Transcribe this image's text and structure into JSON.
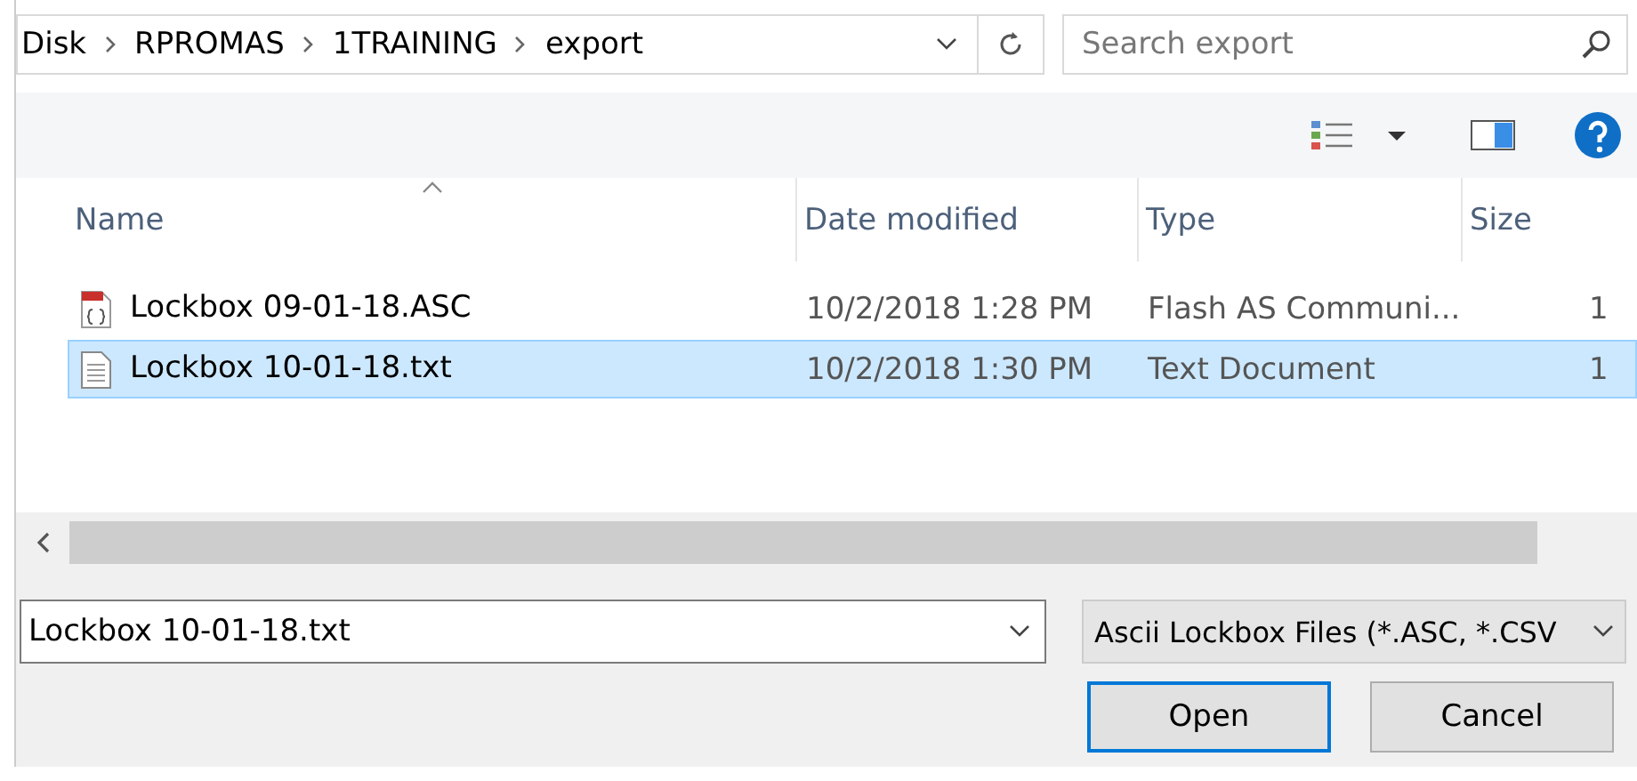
{
  "address": {
    "crumbs": [
      "Disk",
      "RPROMAS",
      "1TRAINING",
      "export"
    ]
  },
  "search": {
    "placeholder": "Search export"
  },
  "columns": [
    {
      "label": "Name",
      "sorted": true
    },
    {
      "label": "Date modified",
      "sorted": false
    },
    {
      "label": "Type",
      "sorted": false
    },
    {
      "label": "Size",
      "sorted": false
    }
  ],
  "files": [
    {
      "name": "Lockbox 09-01-18.ASC",
      "kind": "asc",
      "date": "10/2/2018 1:28 PM",
      "type": "Flash AS Communi...",
      "size": "1",
      "selected": false
    },
    {
      "name": "Lockbox 10-01-18.txt",
      "kind": "txt",
      "date": "10/2/2018 1:30 PM",
      "type": "Text Document",
      "size": "1",
      "selected": true
    }
  ],
  "file_name": {
    "value": "Lockbox 10-01-18.txt"
  },
  "filter": {
    "value": "Ascii Lockbox Files (*.ASC, *.CSV"
  },
  "buttons": [
    {
      "label": "Open",
      "default": true
    },
    {
      "label": "Cancel",
      "default": false
    }
  ]
}
